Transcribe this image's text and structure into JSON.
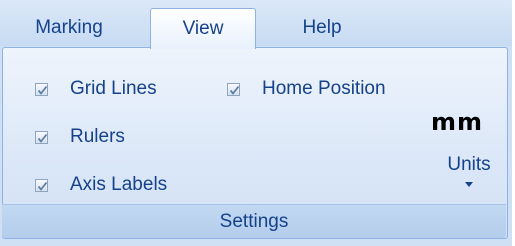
{
  "tabs": [
    {
      "label": "Marking",
      "active": false
    },
    {
      "label": "View",
      "active": true
    },
    {
      "label": "Help",
      "active": false
    }
  ],
  "settings": {
    "group_label": "Settings",
    "grid_lines": {
      "label": "Grid Lines",
      "checked": true
    },
    "home_position": {
      "label": "Home Position",
      "checked": true
    },
    "rulers": {
      "label": "Rulers",
      "checked": true
    },
    "axis_labels": {
      "label": "Axis Labels",
      "checked": true
    },
    "units": {
      "value": "mm",
      "label": "Units"
    }
  },
  "colors": {
    "text": "#15428b",
    "tab_bar": "#cfe0f5",
    "panel": "#dce8f8",
    "footer": "#b4cdeb"
  }
}
